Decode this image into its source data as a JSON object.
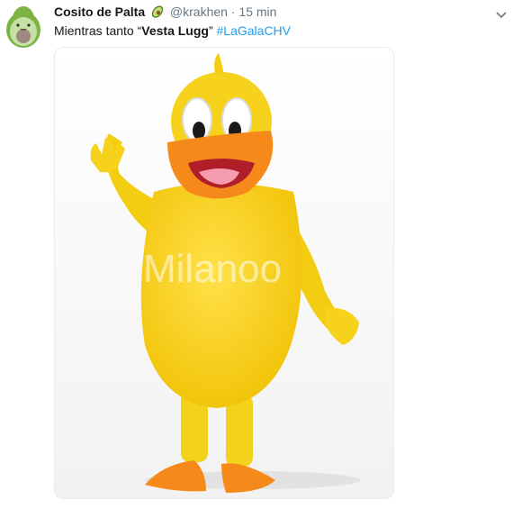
{
  "tweet": {
    "author_name": "Cosito de Palta",
    "author_emoji": "avocado-icon",
    "handle": "@krakhen",
    "separator": "·",
    "time": "15 min",
    "text_prefix": "Mientras tanto “",
    "text_bold": "Vesta Lugg",
    "text_suffix": "” ",
    "hashtag": "#LaGalaCHV",
    "image_watermark": "Milanoo"
  },
  "colors": {
    "accent": "#1da1f2",
    "muted": "#657786",
    "avatar_green": "#8bc34a",
    "duck_yellow": "#f7d21c",
    "duck_orange": "#f38a1c"
  }
}
